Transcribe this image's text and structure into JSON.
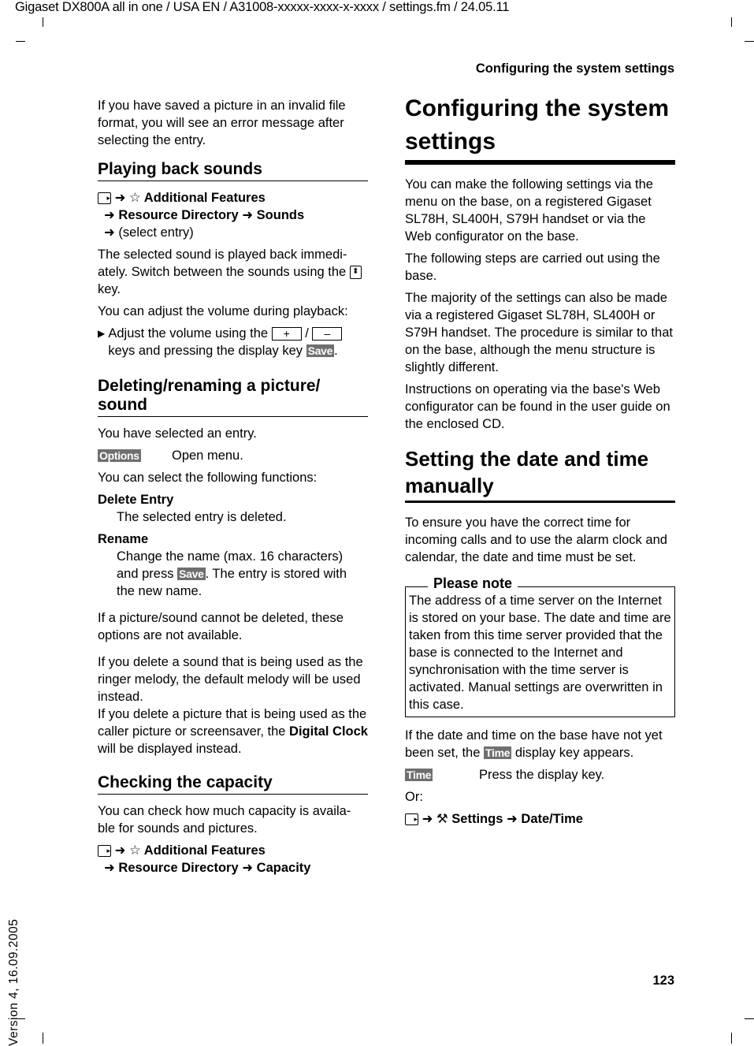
{
  "header": {
    "doc_info": "Gigaset DX800A all in one / USA EN / A31008-xxxxx-xxxx-x-xxxx / settings.fm / 24.05.11",
    "running_head": "Configuring the system settings",
    "page_number": "123",
    "version": "Version 4, 16.09.2005"
  },
  "left": {
    "intro": "If you have saved a picture in an invalid file format, you will see an error message after selecting the entry.",
    "playing": {
      "title": "Playing back sounds",
      "menu": {
        "icon": "menu-key-icon",
        "star_icon": "☆",
        "item1": "Additional Features",
        "item2": "Resource Directory",
        "item3": "Sounds",
        "item4": "(select entry)"
      },
      "p1a": "The selected sound is played back immedi-ately. Switch between the sounds using the",
      "p1b": "key.",
      "p2": "You can adjust the volume during playback:",
      "bullet_a": "Adjust the volume using the",
      "plus_key": "+",
      "slash": "/",
      "minus_key": "–",
      "bullet_b": "keys and pressing the display key",
      "save_key": "Save",
      "period": "."
    },
    "deleting": {
      "title": "Deleting/renaming a picture/ sound",
      "p1": "You have selected an entry.",
      "options_key": "Options",
      "options_desc": "Open menu.",
      "p2": "You can select the following functions:",
      "term1": "Delete Entry",
      "term1_desc": "The selected entry is deleted.",
      "term2": "Rename",
      "term2_desc_a": "Change the name (max. 16 characters) and press",
      "save_key": "Save",
      "term2_desc_b": ". The entry is stored with the new name.",
      "p3": "If a picture/sound cannot be deleted, these options are not available.",
      "p4": "If you delete a sound that is being used as the ringer melody, the default melody will be used instead.",
      "p5a": "If you delete a picture that is being used as the caller picture or screensaver, the",
      "p5_bold": "Digital Clock",
      "p5b": "will be displayed instead."
    },
    "capacity": {
      "title": "Checking the capacity",
      "p1": "You can check how much capacity is availa-ble for sounds and pictures.",
      "menu": {
        "star_icon": "☆",
        "item1": "Additional Features",
        "item2": "Resource Directory",
        "item3": "Capacity"
      }
    }
  },
  "right": {
    "title": "Configuring the system settings",
    "p1": "You can make the following settings via the menu on the base, on a registered Gigaset SL78H, SL400H, S79H handset or via the Web configurator on the base.",
    "p2": "The following steps are carried out using the base.",
    "p3": "The majority of the settings can also be made via a registered Gigaset SL78H, SL400H or S79H handset. The procedure is similar to that on the base, although the menu structure is slightly different.",
    "p4": "Instructions on operating via the base's Web configurator can be found in the user guide on the enclosed CD.",
    "datetime": {
      "title": "Setting the date and time manually",
      "p1": "To ensure you have the correct time for incoming calls and to use the alarm clock and calendar, the date and time must be set.",
      "note_title": "Please note",
      "note_text": "The address of a time server on the Internet is stored on your base. The date and time are taken from this time server provided that the base is connected to the Internet and synchronisation with the time server is activated. Manual settings are overwritten in this case.",
      "p2a": "If the date and time on the base have not yet been set, the",
      "time_key": "Time",
      "p2b": "display key appears.",
      "time_desc": "Press the display key.",
      "or": "Or:",
      "menu": {
        "wrench_icon": "🔧",
        "item1": "Settings",
        "item2": "Date/Time"
      }
    }
  },
  "arrow": "➜"
}
